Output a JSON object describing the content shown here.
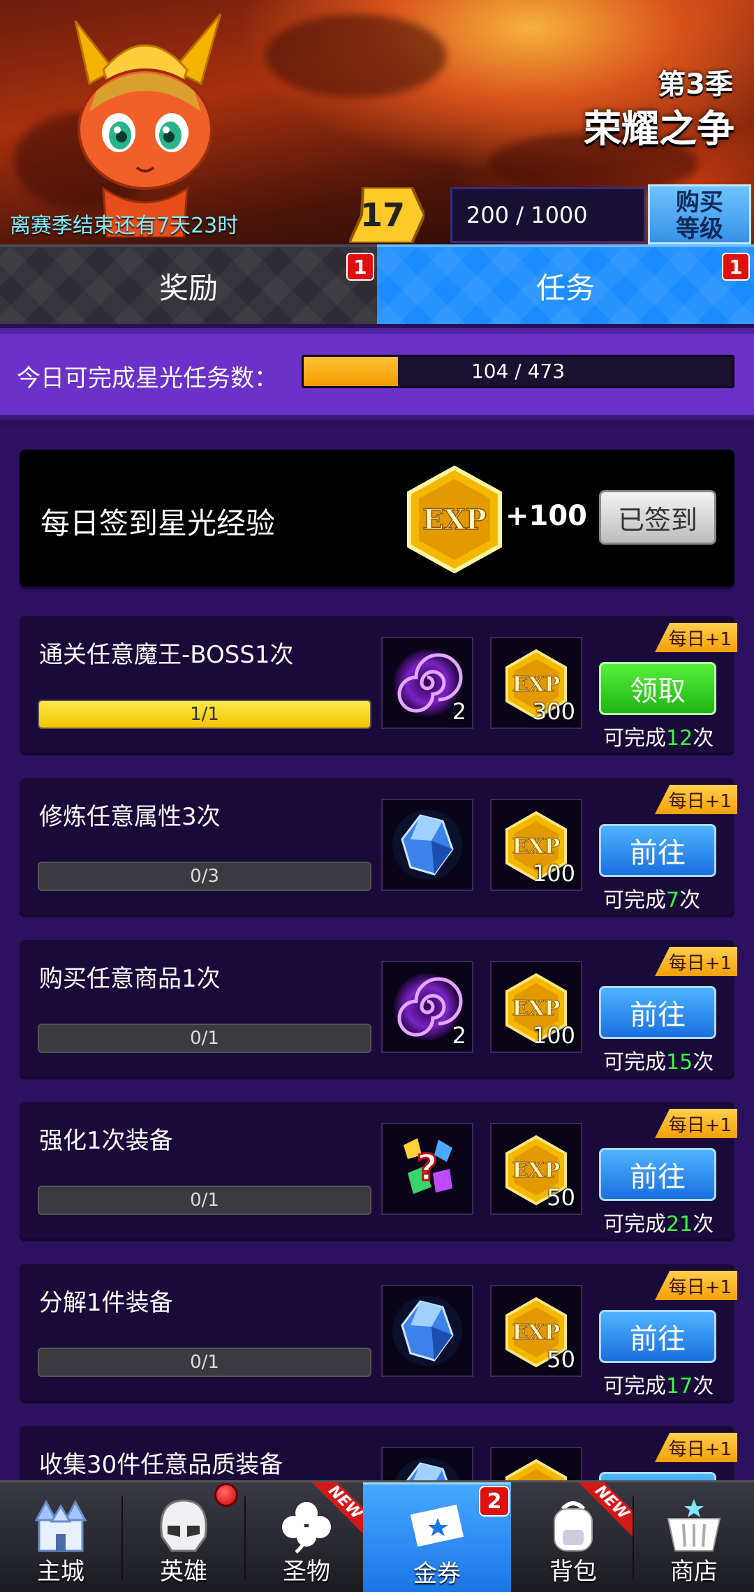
{
  "header": {
    "season_label": "第3季",
    "season_title": "荣耀之争",
    "countdown": "离赛季结束还有7天23时",
    "level": "17",
    "xp_text": "200 / 1000",
    "buy_level_line1": "购买",
    "buy_level_line2": "等级"
  },
  "tabs": [
    {
      "label": "奖励",
      "badge": "1",
      "active": false
    },
    {
      "label": "任务",
      "badge": "1",
      "active": true
    }
  ],
  "daily_limit": {
    "label": "今日可完成星光任务数：",
    "current": 104,
    "max": 473,
    "text": "104 / 473"
  },
  "signin": {
    "label": "每日签到星光经验",
    "exp_icon_text": "EXP",
    "reward": "+100",
    "button": "已签到"
  },
  "tasks": [
    {
      "name": "通关任意魔王-BOSS1次",
      "progress_text": "1/1",
      "progress": 1.0,
      "item1": "vortex",
      "item1_qty": "2",
      "exp_text": "EXP",
      "exp_qty": "300",
      "button": "领取",
      "button_type": "claim",
      "remain_prefix": "可完成",
      "remain_count": "12",
      "remain_suffix": "次",
      "tag": "每日+1"
    },
    {
      "name": "修炼任意属性3次",
      "progress_text": "0/3",
      "progress": 0,
      "item1": "crystal",
      "item1_qty": "",
      "exp_text": "EXP",
      "exp_qty": "100",
      "button": "前往",
      "button_type": "go",
      "remain_prefix": "可完成",
      "remain_count": "7",
      "remain_suffix": "次",
      "tag": "每日+1"
    },
    {
      "name": "购买任意商品1次",
      "progress_text": "0/1",
      "progress": 0,
      "item1": "vortex",
      "item1_qty": "2",
      "exp_text": "EXP",
      "exp_qty": "100",
      "button": "前往",
      "button_type": "go",
      "remain_prefix": "可完成",
      "remain_count": "15",
      "remain_suffix": "次",
      "tag": "每日+1"
    },
    {
      "name": "强化1次装备",
      "progress_text": "0/1",
      "progress": 0,
      "item1": "mystery-gems",
      "item1_qty": "",
      "exp_text": "EXP",
      "exp_qty": "50",
      "button": "前往",
      "button_type": "go",
      "remain_prefix": "可完成",
      "remain_count": "21",
      "remain_suffix": "次",
      "tag": "每日+1"
    },
    {
      "name": "分解1件装备",
      "progress_text": "0/1",
      "progress": 0,
      "item1": "crystal",
      "item1_qty": "",
      "exp_text": "EXP",
      "exp_qty": "50",
      "button": "前往",
      "button_type": "go",
      "remain_prefix": "可完成",
      "remain_count": "17",
      "remain_suffix": "次",
      "tag": "每日+1"
    },
    {
      "name": "收集30件任意品质装备",
      "progress_text": "",
      "progress": 0,
      "item1": "crystal",
      "item1_qty": "",
      "exp_text": "EXP",
      "exp_qty": "",
      "button": "",
      "button_type": "go",
      "remain_prefix": "",
      "remain_count": "",
      "remain_suffix": "",
      "tag": "每日+1"
    }
  ],
  "nav": {
    "items": [
      {
        "label": "主城",
        "icon": "castle-icon"
      },
      {
        "label": "英雄",
        "icon": "hero-helmet-icon"
      },
      {
        "label": "圣物",
        "icon": "clover-icon",
        "new": "NEW"
      },
      {
        "label": "金券",
        "icon": "ticket-icon",
        "badge": "2",
        "active": true
      },
      {
        "label": "背包",
        "icon": "backpack-icon",
        "new": "NEW"
      },
      {
        "label": "商店",
        "icon": "basket-icon"
      }
    ]
  },
  "colors": {
    "accent_blue": "#1a8cff",
    "claim_green": "#1fb514",
    "progress_yellow": "#f3c400",
    "count_green": "#36ff3a",
    "badge_red": "#e01010"
  }
}
